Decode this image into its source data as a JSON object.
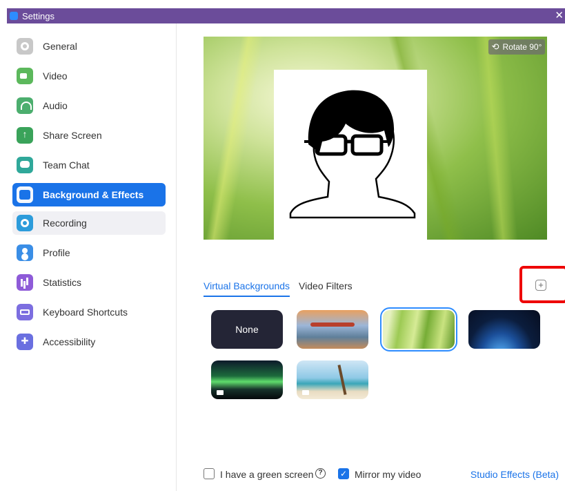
{
  "window": {
    "title": "Settings",
    "close_glyph": "✕"
  },
  "sidebar": {
    "items": [
      {
        "label": "General",
        "icon": "gear-icon"
      },
      {
        "label": "Video",
        "icon": "video-camera-icon"
      },
      {
        "label": "Audio",
        "icon": "headphones-icon"
      },
      {
        "label": "Share Screen",
        "icon": "share-screen-icon"
      },
      {
        "label": "Team Chat",
        "icon": "chat-bubble-icon"
      },
      {
        "label": "Background & Effects",
        "icon": "background-icon",
        "state": "active"
      },
      {
        "label": "Recording",
        "icon": "record-icon",
        "state": "hover"
      },
      {
        "label": "Profile",
        "icon": "profile-icon"
      },
      {
        "label": "Statistics",
        "icon": "statistics-icon"
      },
      {
        "label": "Keyboard Shortcuts",
        "icon": "keyboard-icon"
      },
      {
        "label": "Accessibility",
        "icon": "accessibility-icon"
      }
    ]
  },
  "preview": {
    "rotate_label": "Rotate 90°",
    "rotate_icon": "rotate-icon"
  },
  "tabs": [
    {
      "label": "Virtual Backgrounds",
      "active": true
    },
    {
      "label": "Video Filters",
      "active": false
    }
  ],
  "add_button": {
    "glyph": "+"
  },
  "backgrounds": [
    {
      "label": "None",
      "kind": "none"
    },
    {
      "label": "",
      "kind": "golden-gate-bridge"
    },
    {
      "label": "",
      "kind": "grass",
      "selected": true
    },
    {
      "label": "",
      "kind": "earth-from-space"
    },
    {
      "label": "",
      "kind": "aurora",
      "video": true
    },
    {
      "label": "",
      "kind": "beach",
      "video": true
    }
  ],
  "footer": {
    "green_screen": {
      "label": "I have a green screen",
      "checked": false
    },
    "help_glyph": "?",
    "mirror": {
      "label": "Mirror my video",
      "checked": true,
      "check_glyph": "✓"
    },
    "studio_effects": "Studio Effects (Beta)"
  },
  "colors": {
    "titlebar": "#6b4c9a",
    "accent": "#1a73e8",
    "highlight": "#e00000"
  }
}
